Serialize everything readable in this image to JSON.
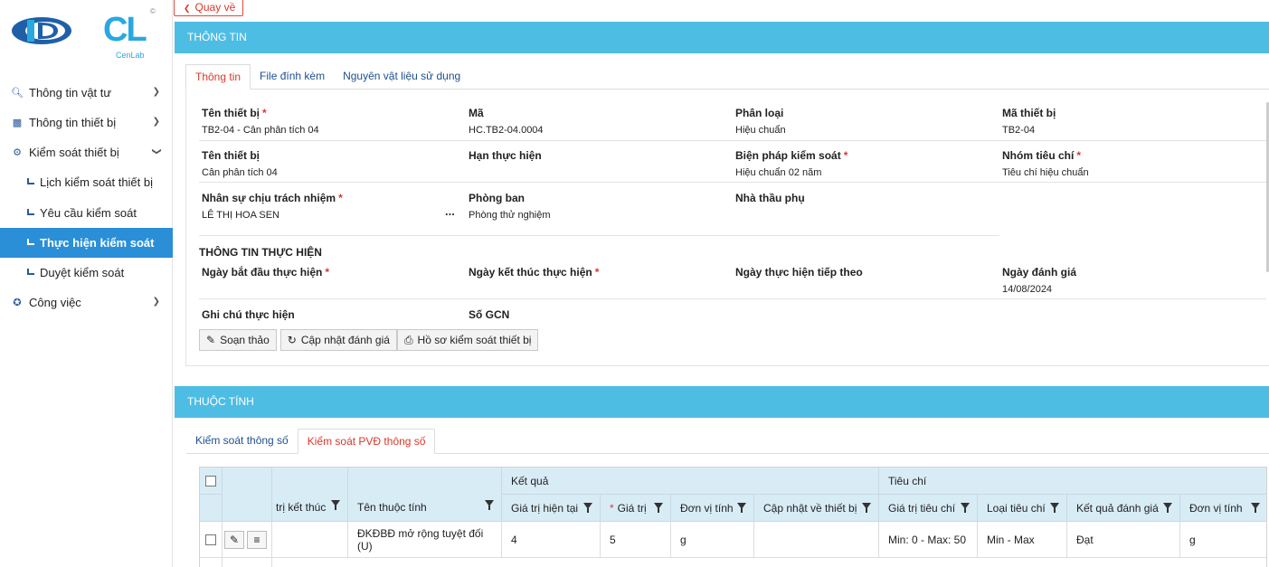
{
  "logo": {
    "brand_sub": "CenLab",
    "copyright": "©",
    "cl": "CL"
  },
  "sidebar": {
    "items": [
      {
        "label": "Thông tin vật tư",
        "icon": "search-doc-icon"
      },
      {
        "label": "Thông tin thiết bị",
        "icon": "grid-icon"
      },
      {
        "label": "Kiểm soát thiết bị",
        "icon": "gears-icon"
      },
      {
        "label": "Công việc",
        "icon": "person-icon"
      }
    ],
    "subitems": [
      {
        "label": "Lịch kiểm soát thiết bị"
      },
      {
        "label": "Yêu cầu kiểm soát"
      },
      {
        "label": "Thực hiện kiểm soát"
      },
      {
        "label": "Duyệt kiểm soát"
      }
    ]
  },
  "back_label": "Quay về",
  "info_section": {
    "title": "THÔNG TIN"
  },
  "tabs": [
    "Thông tin",
    "File đính kèm",
    "Nguyên vật liệu sử dụng"
  ],
  "fields": {
    "ten_thiet_bi": {
      "label": "Tên thiết bị",
      "value": "TB2-04 - Cân phân tích 04"
    },
    "ma": {
      "label": "Mã",
      "value": "HC.TB2-04.0004"
    },
    "phan_loai": {
      "label": "Phân loại",
      "value": "Hiệu chuẩn"
    },
    "ma_thiet_bi": {
      "label": "Mã thiết bị",
      "value": "TB2-04"
    },
    "ten_thiet_bi_2": {
      "label": "Tên thiết bị",
      "value": "Cân phân tích 04"
    },
    "han_thuc_hien": {
      "label": "Hạn thực hiện",
      "value": ""
    },
    "bien_phap": {
      "label": "Biện pháp kiểm soát",
      "value": "Hiệu chuẩn 02 năm"
    },
    "nhom_tieu_chi": {
      "label": "Nhóm tiêu chí",
      "value": "Tiêu chí hiệu chuẩn"
    },
    "nhan_su": {
      "label": "Nhân sự chịu trách nhiệm",
      "value": "LÊ THỊ HOA SEN"
    },
    "phong_ban": {
      "label": "Phòng ban",
      "value": "Phòng thử nghiệm"
    },
    "nha_thau": {
      "label": "Nhà thầu phụ",
      "value": ""
    },
    "exec_title": "THÔNG TIN THỰC HIỆN",
    "ngay_bat_dau": {
      "label": "Ngày bắt đầu thực hiện",
      "value": ""
    },
    "ngay_ket_thuc": {
      "label": "Ngày kết thúc thực hiện",
      "value": ""
    },
    "ngay_tiep_theo": {
      "label": "Ngày thực hiện tiếp theo",
      "value": ""
    },
    "ngay_danh_gia": {
      "label": "Ngày đánh giá",
      "value": "14/08/2024"
    },
    "ghi_chu": {
      "label": "Ghi chú thực hiện",
      "value": ""
    },
    "so_gcn": {
      "label": "Số GCN",
      "value": ""
    },
    "required_mark": "*",
    "dots": "..."
  },
  "toolbar": {
    "draft": "Soạn thảo",
    "update": "Cập nhật đánh giá",
    "profile": "Hồ sơ kiểm soát thiết bị"
  },
  "attr_section": {
    "title": "THUỘC TÍNH"
  },
  "attr_tabs": [
    "Kiểm soát thông số",
    "Kiểm soát PVĐ thông số"
  ],
  "grid": {
    "group_headers": {
      "result": "Kết quả",
      "criteria": "Tiêu chí"
    },
    "columns": [
      "trị kết thúc",
      "Tên thuộc tính",
      "Giá trị hiện tại",
      "Giá trị",
      "Đơn vị tính",
      "Cập nhật về thiết bị",
      "Giá trị tiêu chí",
      "Loại tiêu chí",
      "Kết quả đánh giá",
      "Đơn vị tính"
    ],
    "rows": [
      {
        "tri_ket_thuc": "",
        "ten_thuoc_tinh": "ĐKĐBĐ mở rộng tuyệt đối (U)",
        "gia_tri_hien_tai": "4",
        "gia_tri": "5",
        "don_vi_tinh": "g",
        "cap_nhat": "",
        "gia_tri_tieu_chi": "Min: 0 - Max: 50",
        "loai_tieu_chi": "Min - Max",
        "ket_qua": "Đạt",
        "don_vi_tinh_2": "g"
      }
    ]
  }
}
